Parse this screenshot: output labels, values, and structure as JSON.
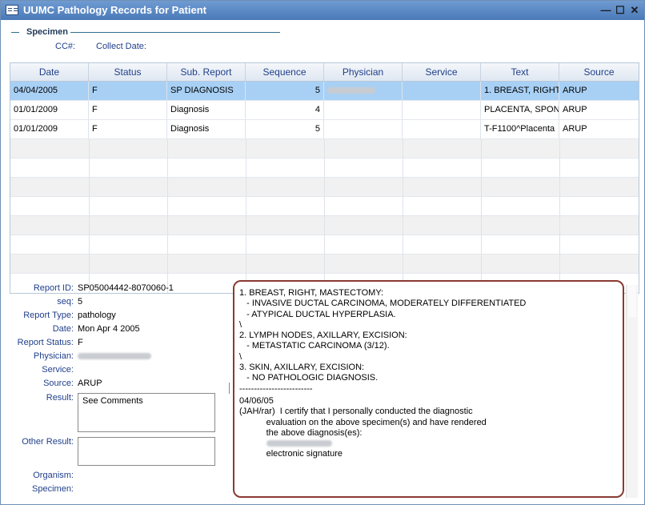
{
  "window": {
    "title": "UUMC Pathology Records for Patient",
    "min_glyph": "—",
    "max_glyph": "☐",
    "close_glyph": "✕",
    "icon": "document-icon"
  },
  "specimen": {
    "section_label": "Specimen",
    "cc_label": "CC#:",
    "collect_date_label": "Collect Date:"
  },
  "grid": {
    "columns": [
      "Date",
      "Status",
      "Sub. Report",
      "Sequence",
      "Physician",
      "Service",
      "Text",
      "Source"
    ],
    "rows": [
      {
        "date": "04/04/2005",
        "status": "F",
        "sub_report": "SP DIAGNOSIS",
        "sequence": "5",
        "physician": "",
        "service": "",
        "text": "1. BREAST, RIGHT",
        "source": "ARUP"
      },
      {
        "date": "01/01/2009",
        "status": "F",
        "sub_report": "Diagnosis",
        "sequence": "4",
        "physician": "",
        "service": "",
        "text": "PLACENTA, SPON",
        "source": "ARUP"
      },
      {
        "date": "01/01/2009",
        "status": "F",
        "sub_report": "Diagnosis",
        "sequence": "5",
        "physician": "",
        "service": "",
        "text": "T-F1100^Placenta",
        "source": "ARUP"
      }
    ],
    "empty_rows": 7,
    "selected_row": 0
  },
  "details": {
    "report_id_label": "Report ID:",
    "report_id": "SP05004442-8070060-1",
    "seq_label": "seq:",
    "seq": "5",
    "report_type_label": "Report Type:",
    "report_type": "pathology",
    "date_label": "Date:",
    "date": "Mon Apr 4 2005",
    "report_status_label": "Report Status:",
    "report_status": "F",
    "physician_label": "Physician:",
    "service_label": "Service:",
    "service": "",
    "source_label": "Source:",
    "source": "ARUP",
    "result_label": "Result:",
    "result": "See Comments",
    "other_result_label": "Other Result:",
    "other_result": "",
    "organism_label": "Organism:",
    "specimen_label": "Specimen:"
  },
  "report_text": [
    "1. BREAST, RIGHT, MASTECTOMY:",
    "   - INVASIVE DUCTAL CARCINOMA, MODERATELY DIFFERENTIATED",
    "   - ATYPICAL DUCTAL HYPERPLASIA.",
    "\\",
    "2. LYMPH NODES, AXILLARY, EXCISION:",
    "   - METASTATIC CARCINOMA (3/12).",
    "\\",
    "3. SKIN, AXILLARY, EXCISION:",
    "   - NO PATHOLOGIC DIAGNOSIS.",
    "-------------------------",
    "04/06/05",
    "(JAH/rar)  I certify that I personally conducted the diagnostic",
    "           evaluation on the above specimen(s) and have rendered",
    "           the above diagnosis(es):",
    "",
    "           electronic signature"
  ],
  "colors": {
    "titlebar": "#5a87c4",
    "selected_row": "#a8d0f5",
    "label_blue": "#1f3f8a",
    "highlight_border": "#8a3a33"
  }
}
